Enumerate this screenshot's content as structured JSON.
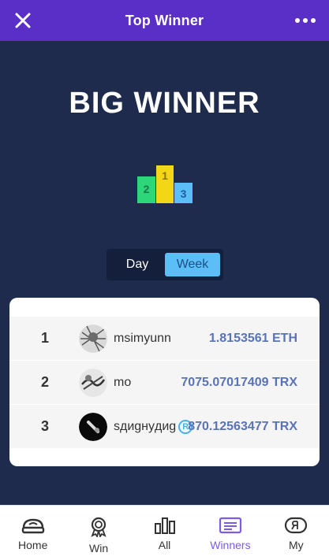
{
  "header": {
    "title": "Top Winner",
    "close_icon": "close-icon",
    "more_icon": "more-dots-icon"
  },
  "hero": {
    "title": "BIG WINNER",
    "podium_icon": "podium-icon",
    "podium_labels": [
      "2",
      "1",
      "3"
    ]
  },
  "period_toggle": {
    "options": [
      "Day",
      "Week"
    ],
    "selected": "Week"
  },
  "winners": [
    {
      "rank": "1",
      "name": "msimyunn",
      "amount": "1.8153561 ETH",
      "verified": false
    },
    {
      "rank": "2",
      "name": "mo",
      "amount": "7075.07017409 TRX",
      "verified": false
    },
    {
      "rank": "3",
      "name": "sдиgнyдиg",
      "amount": "870.12563477 TRX",
      "verified": true,
      "verified_mark": "R"
    }
  ],
  "nav": {
    "items": [
      {
        "label": "Home",
        "icon": "home-icon"
      },
      {
        "label": "Win",
        "icon": "medal-icon"
      },
      {
        "label": "All",
        "icon": "bar-chart-icon"
      },
      {
        "label": "Winners",
        "icon": "list-card-icon"
      },
      {
        "label": "My",
        "icon": "profile-icon"
      }
    ],
    "active": "Winners"
  },
  "colors": {
    "header_bg": "#5a2fc8",
    "page_bg": "#1f2b4d",
    "accent": "#5bbef7",
    "amount": "#5a73b7",
    "nav_active": "#7b5be8"
  }
}
